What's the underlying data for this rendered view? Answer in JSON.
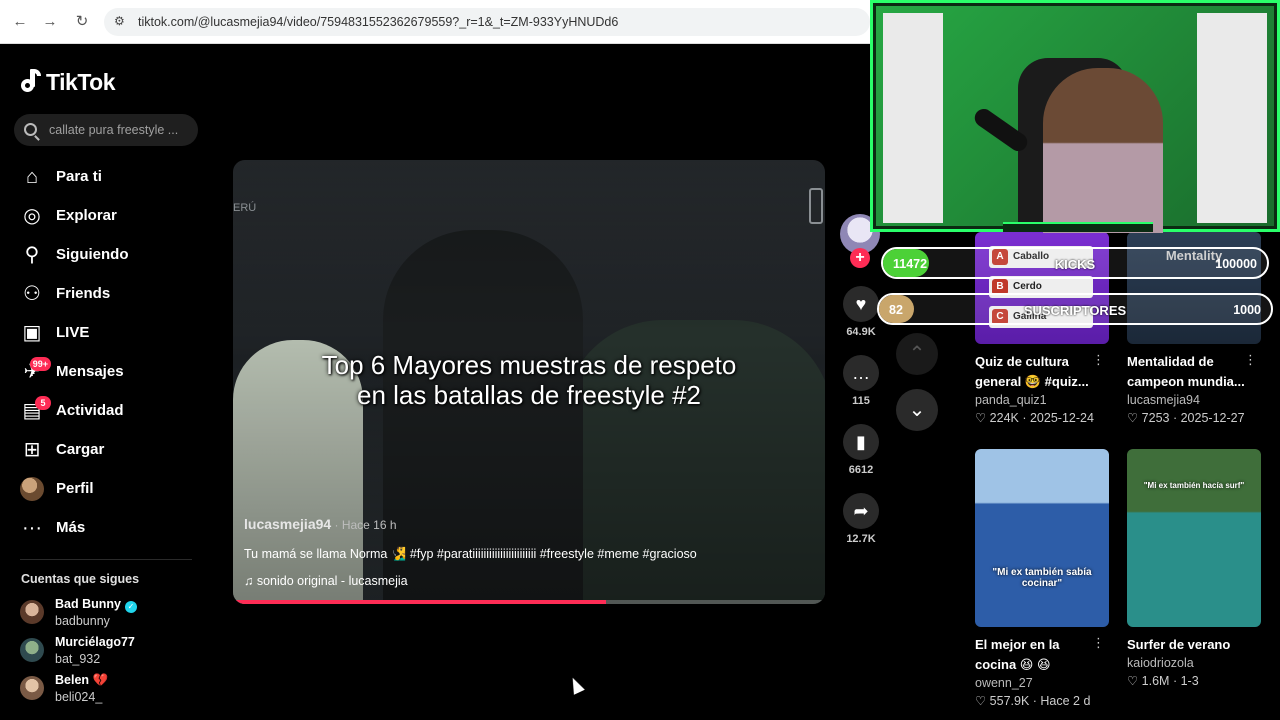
{
  "browser": {
    "url": "tiktok.com/@lucasmejia94/video/7594831552362679559?_r=1&_t=ZM-933YyHNUDd6"
  },
  "sidebar": {
    "logo": "TikTok",
    "search_placeholder": "callate pura freestyle ...",
    "items": [
      {
        "label": "Para ti",
        "icon": "home-icon"
      },
      {
        "label": "Explorar",
        "icon": "compass-icon"
      },
      {
        "label": "Siguiendo",
        "icon": "following-icon"
      },
      {
        "label": "Friends",
        "icon": "friends-icon"
      },
      {
        "label": "LIVE",
        "icon": "live-icon"
      },
      {
        "label": "Mensajes",
        "icon": "messages-icon",
        "badge": "99+"
      },
      {
        "label": "Actividad",
        "icon": "activity-icon",
        "badge": "5"
      },
      {
        "label": "Cargar",
        "icon": "upload-icon"
      },
      {
        "label": "Perfil",
        "icon": "avatar"
      },
      {
        "label": "Más",
        "icon": "more-icon"
      }
    ],
    "following_title": "Cuentas que sigues",
    "following": [
      {
        "name": "Bad Bunny",
        "handle": "badbunny",
        "verified": true
      },
      {
        "name": "Murciélago77",
        "handle": "bat_932"
      },
      {
        "name": "Belen",
        "handle": "beli024_",
        "emoji": "💔"
      }
    ]
  },
  "video": {
    "overlay_title_line1": "Top 6 Mayores muestras de respeto",
    "overlay_title_line2": "en las batallas de freestyle #2",
    "watermark_left": "ERÚ",
    "username": "lucasmejia94",
    "time": " · Hace 16 h",
    "description": "Tu mamá se llama Norma 🧏‍♂️ #fyp #paratiiiiiiiiiiiiiiiiiiiiiii #freestyle #meme #gracioso",
    "sound": "♫  sonido original - lucasmejia",
    "progress": 0.63
  },
  "actions": {
    "likes": "64.9K",
    "comments": "115",
    "saves": "6612",
    "shares": "12.7K"
  },
  "recommendations": [
    {
      "title": "Quiz de cultura general 🤓 #quiz...",
      "user": "panda_quiz1",
      "meta": "♡ 224K · 2025-12-24"
    },
    {
      "title": "Mentalidad de campeon mundia...",
      "user": "lucasmejia94",
      "meta": "♡ 7253 · 2025-12-27"
    },
    {
      "title": "El mejor en la cocina 😆 😆",
      "user": "owenn_27",
      "meta": "♡ 557.9K · Hace 2 d",
      "caption": "\"Mi ex también sabía cocinar\""
    },
    {
      "title": "Surfer de verano",
      "user": "kaiodriozola",
      "meta": "♡ 1.6M · 1-3",
      "caption": "\"Mi ex también hacía surf\""
    }
  ],
  "thumb_labels": {
    "quiz_options": [
      "Caballo",
      "Cerdo",
      "Gallina"
    ],
    "quiz_letters": [
      "A",
      "B",
      "C"
    ],
    "mentality_label": "Mentality"
  },
  "stream": {
    "kicks": {
      "current": "11472",
      "label": "KICKS",
      "goal": "100000",
      "fraction": 0.115,
      "color": "#4cd137"
    },
    "subs": {
      "current": "82",
      "label": "SUSCRIPTORES",
      "goal": "1000",
      "fraction": 0.082,
      "color": "#c9a66b"
    }
  }
}
